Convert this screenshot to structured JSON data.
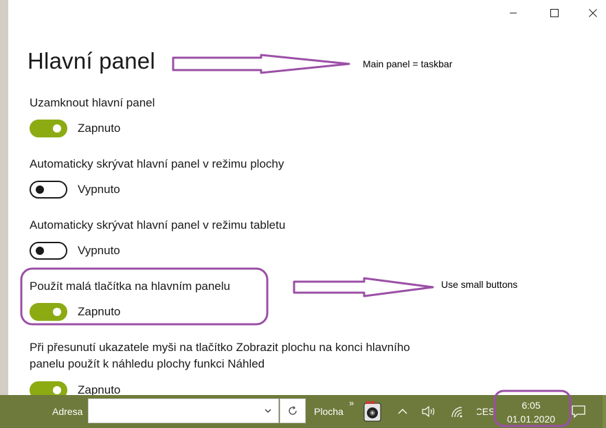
{
  "window": {
    "minimize_icon": "minimize-icon",
    "maximize_icon": "maximize-icon",
    "close_icon": "close-icon"
  },
  "page": {
    "title": "Hlavní panel"
  },
  "settings": [
    {
      "label": "Uzamknout hlavní panel",
      "state": "Zapnuto",
      "on": true
    },
    {
      "label": "Automaticky skrývat hlavní panel v režimu plochy",
      "state": "Vypnuto",
      "on": false
    },
    {
      "label": "Automaticky skrývat hlavní panel v režimu tabletu",
      "state": "Vypnuto",
      "on": false
    },
    {
      "label": "Použít malá tlačítka na hlavním panelu",
      "state": "Zapnuto",
      "on": true
    },
    {
      "label": "Při přesunutí ukazatele myši na tlačítko Zobrazit plochu na konci hlavního panelu použít k náhledu plochy funkci Náhled",
      "state": "Zapnuto",
      "on": true
    }
  ],
  "annotations": {
    "main_panel": "Main panel = taskbar",
    "small_buttons": "Use small buttons",
    "color": "#9b4fa6"
  },
  "taskbar": {
    "address_label": "Adresa",
    "address_value": "",
    "desktop_label": "Plocha",
    "more_glyph": "»",
    "language": "CES",
    "time": "6:05",
    "date": "01.01.2020"
  },
  "colors": {
    "accent": "#8cab13",
    "taskbar": "#6e7a3b",
    "annotation": "#9b4fa6"
  }
}
